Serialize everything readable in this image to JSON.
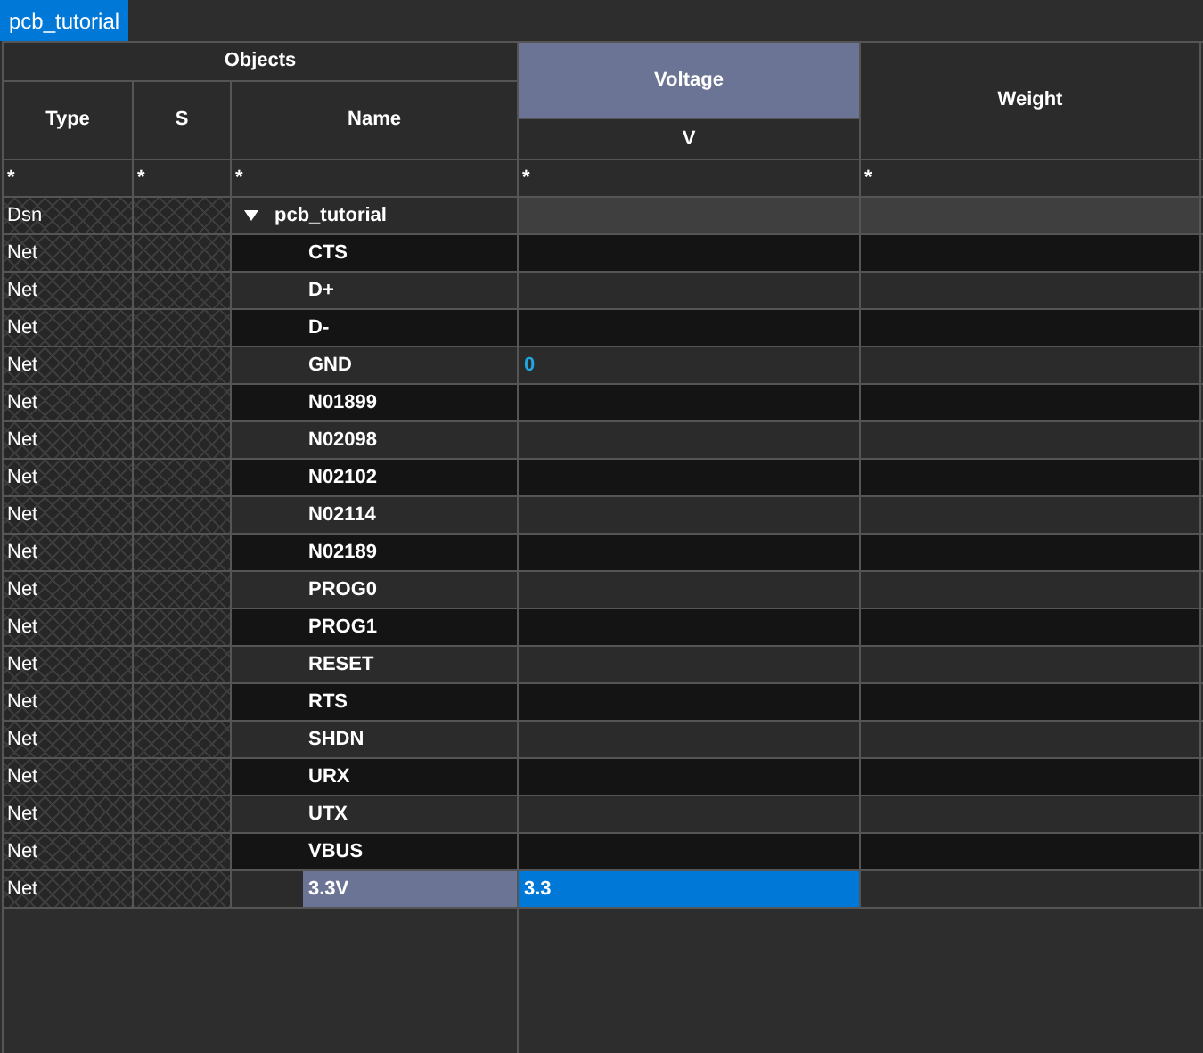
{
  "tab": {
    "label": "pcb_tutorial",
    "selected": true
  },
  "header": {
    "group": "Objects",
    "columns": [
      {
        "label": "Type",
        "selected": false
      },
      {
        "label": "S",
        "selected": false
      },
      {
        "label": "Name",
        "selected": false
      },
      {
        "label": "Voltage",
        "unit": "V",
        "selected": true
      },
      {
        "label": "Weight",
        "selected": false
      }
    ]
  },
  "filters": [
    "*",
    "*",
    "*",
    "*",
    "*"
  ],
  "tree": {
    "type": "Dsn",
    "name": "pcb_tutorial",
    "expanded": true,
    "children": [
      {
        "type": "Net",
        "name": "CTS",
        "selected": false
      },
      {
        "type": "Net",
        "name": "D+",
        "selected": false
      },
      {
        "type": "Net",
        "name": "D-",
        "selected": false
      },
      {
        "type": "Net",
        "name": "GND",
        "voltage": "0",
        "voltage_highlight": true,
        "selected": false
      },
      {
        "type": "Net",
        "name": "N01899",
        "selected": false
      },
      {
        "type": "Net",
        "name": "N02098",
        "selected": false
      },
      {
        "type": "Net",
        "name": "N02102",
        "selected": false
      },
      {
        "type": "Net",
        "name": "N02114",
        "selected": false
      },
      {
        "type": "Net",
        "name": "N02189",
        "selected": false
      },
      {
        "type": "Net",
        "name": "PROG0",
        "selected": false
      },
      {
        "type": "Net",
        "name": "PROG1",
        "selected": false
      },
      {
        "type": "Net",
        "name": "RESET",
        "selected": false
      },
      {
        "type": "Net",
        "name": "RTS",
        "selected": false
      },
      {
        "type": "Net",
        "name": "SHDN",
        "selected": false
      },
      {
        "type": "Net",
        "name": "URX",
        "selected": false
      },
      {
        "type": "Net",
        "name": "UTX",
        "selected": false
      },
      {
        "type": "Net",
        "name": "VBUS",
        "selected": false
      },
      {
        "type": "Net",
        "name": "3.3V",
        "voltage": "3.3",
        "selected": true
      }
    ]
  }
}
